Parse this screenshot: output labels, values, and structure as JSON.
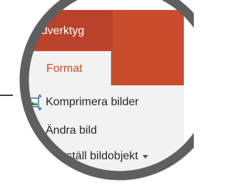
{
  "ribbon": {
    "contextual_group_label": "Bildverktyg",
    "tabs": [
      {
        "label": "Format",
        "active": true
      }
    ],
    "commands": [
      {
        "label": "Komprimera bilder",
        "icon": "compress-pictures-icon"
      },
      {
        "label": "Ändra bild",
        "icon": "change-picture-icon"
      },
      {
        "label": "Återställ bildobjekt",
        "icon": "reset-picture-icon",
        "has_dropdown": true
      }
    ]
  },
  "colors": {
    "accent": "#c94d2c",
    "accent_dark": "#b8432a",
    "ribbon_body": "#f2f2f2",
    "ring": "#5f5f5f",
    "text": "#262626"
  }
}
